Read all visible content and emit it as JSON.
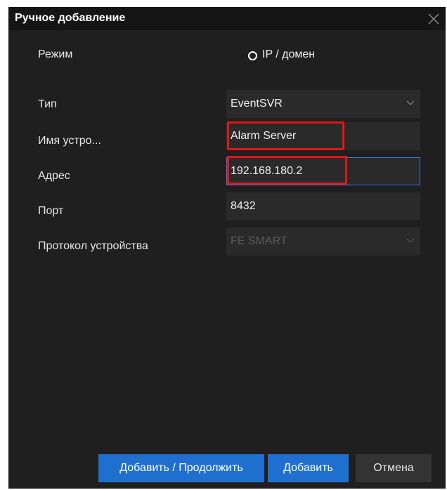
{
  "dialog": {
    "title": "Ручное добавление",
    "close_icon": "close-x-icon"
  },
  "mode": {
    "label": "Режим",
    "option": "IP / домен",
    "selected": true
  },
  "form": {
    "type_label": "Тип",
    "type_value": "EventSVR",
    "name_label": "Имя устро...",
    "name_value": "Alarm Server",
    "address_label": "Адрес",
    "address_value": "192.168.180.2",
    "port_label": "Порт",
    "port_value": "8432",
    "protocol_label": "Протокол устройства",
    "protocol_value": "FE SMART"
  },
  "buttons": {
    "add_continue": "Добавить / Продолжить",
    "add": "Добавить",
    "cancel": "Отмена"
  },
  "colors": {
    "background": "#1f1f1f",
    "titlebar": "#151515",
    "field": "#2a2a2a",
    "primary": "#1f6fcf",
    "focus": "#3a7bd5",
    "highlight": "#e0151b"
  }
}
